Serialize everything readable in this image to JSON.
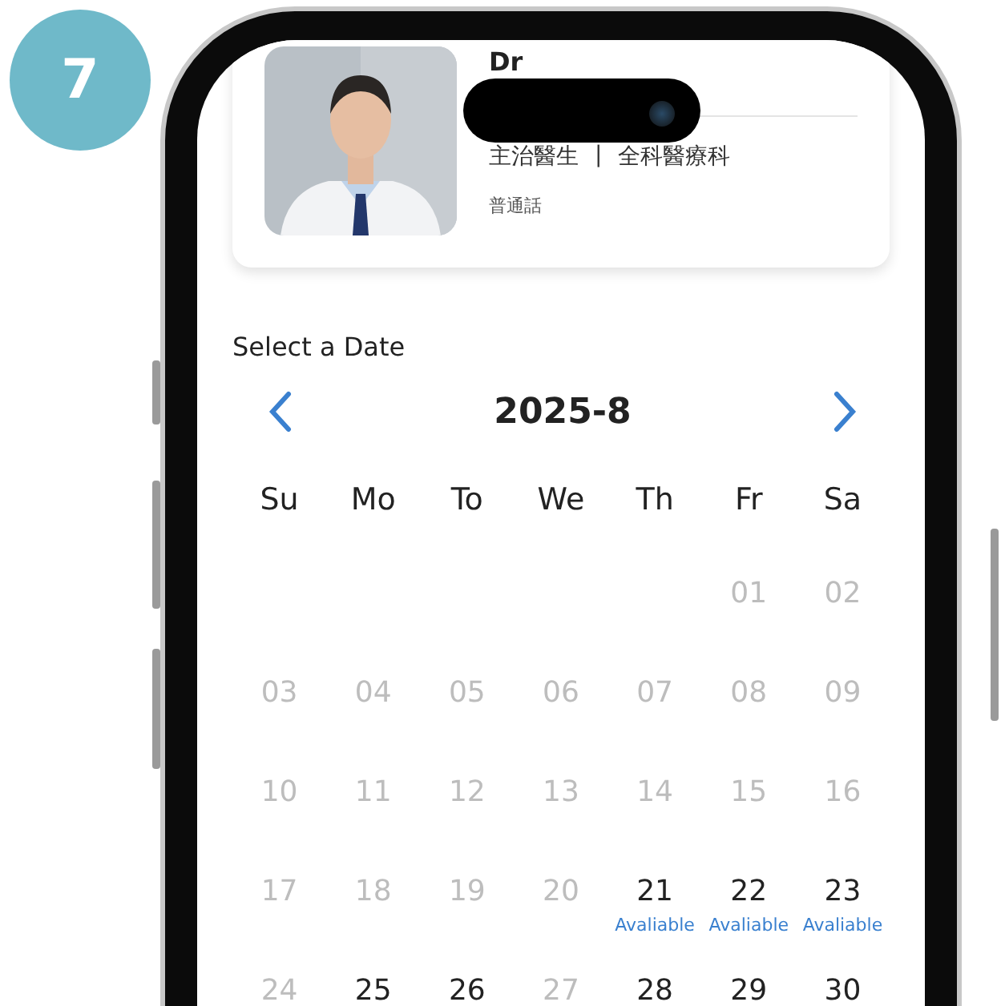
{
  "step_badge": "7",
  "doctor": {
    "name": "Dr",
    "title": "主治醫生",
    "separator": "|",
    "department": "全科醫療科",
    "language": "普通話"
  },
  "calendar": {
    "prompt": "Select a Date",
    "month": "2025-8",
    "weekdays": [
      "Su",
      "Mo",
      "To",
      "We",
      "Th",
      "Fr",
      "Sa"
    ],
    "weeks": [
      {
        "days": [
          {
            "kind": "blank"
          },
          {
            "kind": "blank"
          },
          {
            "kind": "blank"
          },
          {
            "kind": "blank"
          },
          {
            "kind": "blank"
          },
          {
            "kind": "day",
            "label": "01",
            "disabled": true
          },
          {
            "kind": "day",
            "label": "02",
            "disabled": true
          }
        ]
      },
      {
        "days": [
          {
            "kind": "day",
            "label": "03",
            "disabled": true
          },
          {
            "kind": "day",
            "label": "04",
            "disabled": true
          },
          {
            "kind": "day",
            "label": "05",
            "disabled": true
          },
          {
            "kind": "day",
            "label": "06",
            "disabled": true
          },
          {
            "kind": "day",
            "label": "07",
            "disabled": true
          },
          {
            "kind": "day",
            "label": "08",
            "disabled": true
          },
          {
            "kind": "day",
            "label": "09",
            "disabled": true
          }
        ]
      },
      {
        "days": [
          {
            "kind": "day",
            "label": "10",
            "disabled": true
          },
          {
            "kind": "day",
            "label": "11",
            "disabled": true
          },
          {
            "kind": "day",
            "label": "12",
            "disabled": true
          },
          {
            "kind": "day",
            "label": "13",
            "disabled": true
          },
          {
            "kind": "day",
            "label": "14",
            "disabled": true
          },
          {
            "kind": "day",
            "label": "15",
            "disabled": true
          },
          {
            "kind": "day",
            "label": "16",
            "disabled": true
          }
        ]
      },
      {
        "days": [
          {
            "kind": "day",
            "label": "17",
            "disabled": true
          },
          {
            "kind": "day",
            "label": "18",
            "disabled": true
          },
          {
            "kind": "day",
            "label": "19",
            "disabled": true
          },
          {
            "kind": "day",
            "label": "20",
            "disabled": true
          },
          {
            "kind": "day",
            "label": "21",
            "disabled": false,
            "note": "Avaliable"
          },
          {
            "kind": "day",
            "label": "22",
            "disabled": false,
            "note": "Avaliable"
          },
          {
            "kind": "day",
            "label": "23",
            "disabled": false,
            "note": "Avaliable"
          }
        ]
      },
      {
        "days": [
          {
            "kind": "day",
            "label": "24",
            "disabled": true
          },
          {
            "kind": "day",
            "label": "25",
            "disabled": false
          },
          {
            "kind": "day",
            "label": "26",
            "disabled": false
          },
          {
            "kind": "day",
            "label": "27",
            "disabled": true
          },
          {
            "kind": "day",
            "label": "28",
            "disabled": false
          },
          {
            "kind": "day",
            "label": "29",
            "disabled": false
          },
          {
            "kind": "day",
            "label": "30",
            "disabled": false
          }
        ]
      }
    ]
  }
}
